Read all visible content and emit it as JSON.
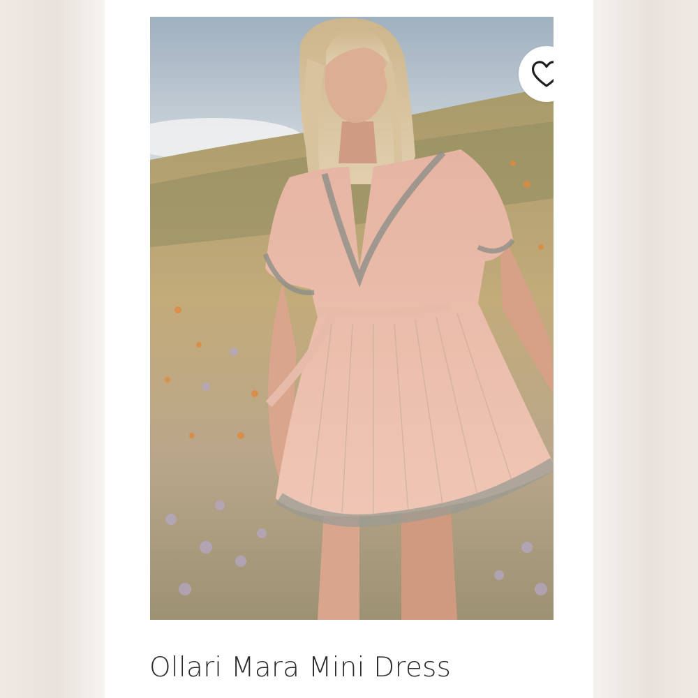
{
  "product": {
    "title": "Ollari Mara Mini Dress"
  },
  "favorite": {
    "icon": "heart-outline-icon"
  },
  "image": {
    "subject": "product-photo"
  },
  "colors": {
    "background": "#ffffff",
    "side_blur": "#ebe4de",
    "title_text": "#2b2b2b",
    "dress": "#e9b7a4"
  }
}
